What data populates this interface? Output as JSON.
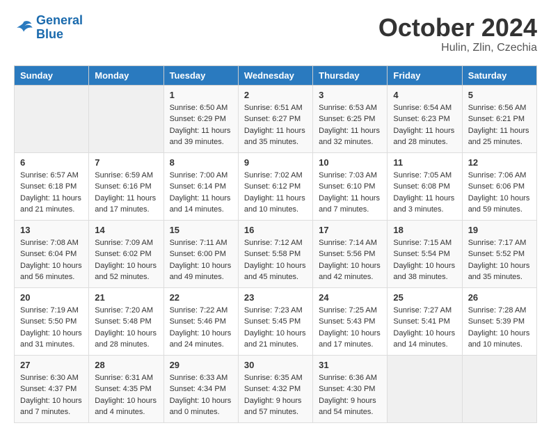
{
  "header": {
    "logo_line1": "General",
    "logo_line2": "Blue",
    "month_title": "October 2024",
    "location": "Hulin, Zlin, Czechia"
  },
  "days_of_week": [
    "Sunday",
    "Monday",
    "Tuesday",
    "Wednesday",
    "Thursday",
    "Friday",
    "Saturday"
  ],
  "weeks": [
    [
      {
        "day": "",
        "detail": ""
      },
      {
        "day": "",
        "detail": ""
      },
      {
        "day": "1",
        "detail": "Sunrise: 6:50 AM\nSunset: 6:29 PM\nDaylight: 11 hours and 39 minutes."
      },
      {
        "day": "2",
        "detail": "Sunrise: 6:51 AM\nSunset: 6:27 PM\nDaylight: 11 hours and 35 minutes."
      },
      {
        "day": "3",
        "detail": "Sunrise: 6:53 AM\nSunset: 6:25 PM\nDaylight: 11 hours and 32 minutes."
      },
      {
        "day": "4",
        "detail": "Sunrise: 6:54 AM\nSunset: 6:23 PM\nDaylight: 11 hours and 28 minutes."
      },
      {
        "day": "5",
        "detail": "Sunrise: 6:56 AM\nSunset: 6:21 PM\nDaylight: 11 hours and 25 minutes."
      }
    ],
    [
      {
        "day": "6",
        "detail": "Sunrise: 6:57 AM\nSunset: 6:18 PM\nDaylight: 11 hours and 21 minutes."
      },
      {
        "day": "7",
        "detail": "Sunrise: 6:59 AM\nSunset: 6:16 PM\nDaylight: 11 hours and 17 minutes."
      },
      {
        "day": "8",
        "detail": "Sunrise: 7:00 AM\nSunset: 6:14 PM\nDaylight: 11 hours and 14 minutes."
      },
      {
        "day": "9",
        "detail": "Sunrise: 7:02 AM\nSunset: 6:12 PM\nDaylight: 11 hours and 10 minutes."
      },
      {
        "day": "10",
        "detail": "Sunrise: 7:03 AM\nSunset: 6:10 PM\nDaylight: 11 hours and 7 minutes."
      },
      {
        "day": "11",
        "detail": "Sunrise: 7:05 AM\nSunset: 6:08 PM\nDaylight: 11 hours and 3 minutes."
      },
      {
        "day": "12",
        "detail": "Sunrise: 7:06 AM\nSunset: 6:06 PM\nDaylight: 10 hours and 59 minutes."
      }
    ],
    [
      {
        "day": "13",
        "detail": "Sunrise: 7:08 AM\nSunset: 6:04 PM\nDaylight: 10 hours and 56 minutes."
      },
      {
        "day": "14",
        "detail": "Sunrise: 7:09 AM\nSunset: 6:02 PM\nDaylight: 10 hours and 52 minutes."
      },
      {
        "day": "15",
        "detail": "Sunrise: 7:11 AM\nSunset: 6:00 PM\nDaylight: 10 hours and 49 minutes."
      },
      {
        "day": "16",
        "detail": "Sunrise: 7:12 AM\nSunset: 5:58 PM\nDaylight: 10 hours and 45 minutes."
      },
      {
        "day": "17",
        "detail": "Sunrise: 7:14 AM\nSunset: 5:56 PM\nDaylight: 10 hours and 42 minutes."
      },
      {
        "day": "18",
        "detail": "Sunrise: 7:15 AM\nSunset: 5:54 PM\nDaylight: 10 hours and 38 minutes."
      },
      {
        "day": "19",
        "detail": "Sunrise: 7:17 AM\nSunset: 5:52 PM\nDaylight: 10 hours and 35 minutes."
      }
    ],
    [
      {
        "day": "20",
        "detail": "Sunrise: 7:19 AM\nSunset: 5:50 PM\nDaylight: 10 hours and 31 minutes."
      },
      {
        "day": "21",
        "detail": "Sunrise: 7:20 AM\nSunset: 5:48 PM\nDaylight: 10 hours and 28 minutes."
      },
      {
        "day": "22",
        "detail": "Sunrise: 7:22 AM\nSunset: 5:46 PM\nDaylight: 10 hours and 24 minutes."
      },
      {
        "day": "23",
        "detail": "Sunrise: 7:23 AM\nSunset: 5:45 PM\nDaylight: 10 hours and 21 minutes."
      },
      {
        "day": "24",
        "detail": "Sunrise: 7:25 AM\nSunset: 5:43 PM\nDaylight: 10 hours and 17 minutes."
      },
      {
        "day": "25",
        "detail": "Sunrise: 7:27 AM\nSunset: 5:41 PM\nDaylight: 10 hours and 14 minutes."
      },
      {
        "day": "26",
        "detail": "Sunrise: 7:28 AM\nSunset: 5:39 PM\nDaylight: 10 hours and 10 minutes."
      }
    ],
    [
      {
        "day": "27",
        "detail": "Sunrise: 6:30 AM\nSunset: 4:37 PM\nDaylight: 10 hours and 7 minutes."
      },
      {
        "day": "28",
        "detail": "Sunrise: 6:31 AM\nSunset: 4:35 PM\nDaylight: 10 hours and 4 minutes."
      },
      {
        "day": "29",
        "detail": "Sunrise: 6:33 AM\nSunset: 4:34 PM\nDaylight: 10 hours and 0 minutes."
      },
      {
        "day": "30",
        "detail": "Sunrise: 6:35 AM\nSunset: 4:32 PM\nDaylight: 9 hours and 57 minutes."
      },
      {
        "day": "31",
        "detail": "Sunrise: 6:36 AM\nSunset: 4:30 PM\nDaylight: 9 hours and 54 minutes."
      },
      {
        "day": "",
        "detail": ""
      },
      {
        "day": "",
        "detail": ""
      }
    ]
  ]
}
